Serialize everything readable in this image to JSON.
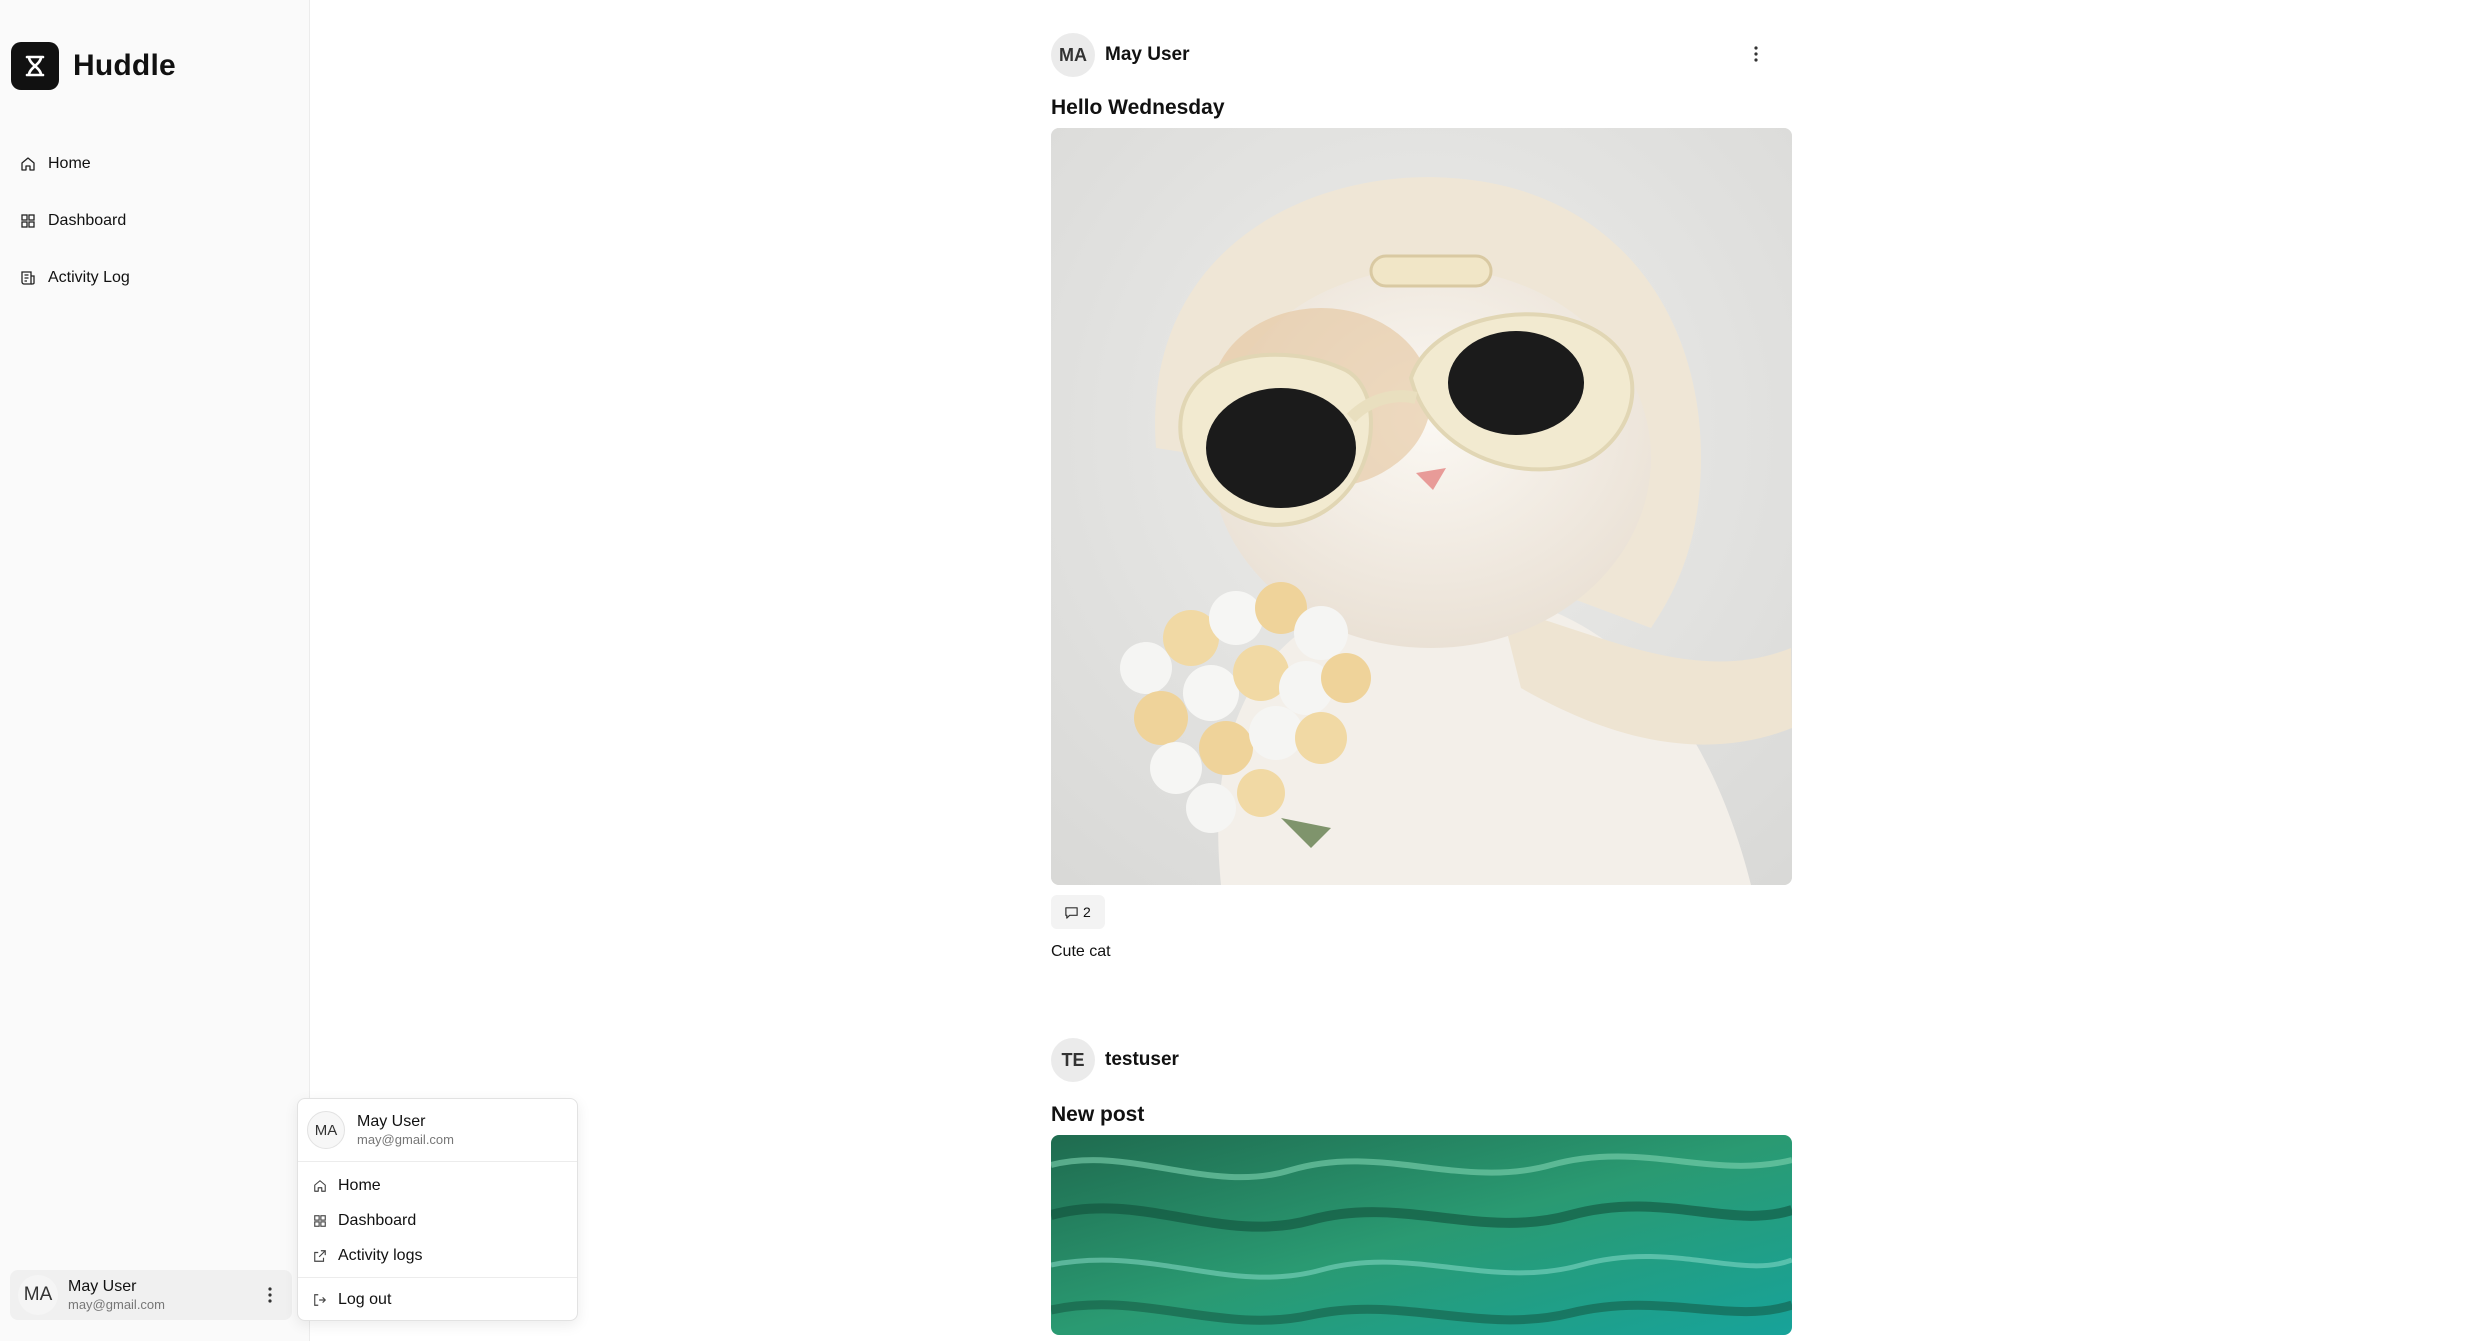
{
  "app": {
    "name": "Huddle"
  },
  "sidebar": {
    "items": [
      {
        "label": "Home",
        "icon": "home-icon"
      },
      {
        "label": "Dashboard",
        "icon": "dashboard-icon"
      },
      {
        "label": "Activity Log",
        "icon": "activity-log-icon"
      }
    ]
  },
  "current_user": {
    "initials": "MA",
    "name": "May User",
    "email": "may@gmail.com"
  },
  "user_menu": {
    "items": [
      {
        "label": "Home",
        "icon": "home-icon"
      },
      {
        "label": "Dashboard",
        "icon": "dashboard-icon"
      },
      {
        "label": "Activity logs",
        "icon": "external-link-icon"
      }
    ],
    "logout_label": "Log out"
  },
  "posts": [
    {
      "author_initials": "MA",
      "author": "May User",
      "title": "Hello Wednesday",
      "image": "cat-in-headscarf-and-sunglasses-holding-bouquet",
      "comment_count": "2",
      "caption": "Cute cat"
    },
    {
      "author_initials": "TE",
      "author": "testuser",
      "title": "New post",
      "image": "green-water-surface"
    }
  ]
}
